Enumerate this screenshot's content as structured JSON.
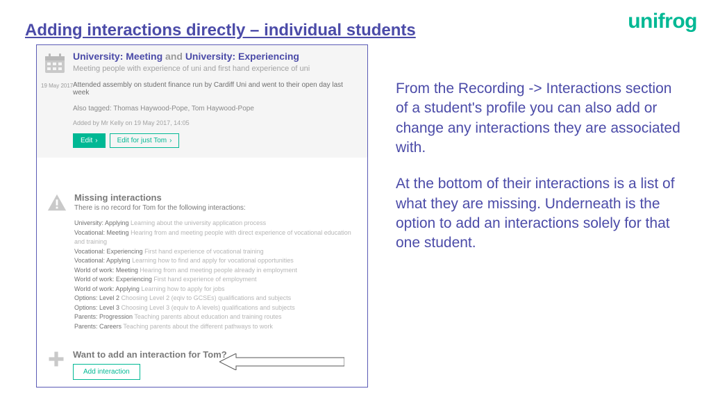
{
  "slide": {
    "title": "Adding interactions directly – individual students",
    "logo": "unifrog"
  },
  "card": {
    "title_a": "University: Meeting",
    "title_and": "and",
    "title_b": "University: Experiencing",
    "subtitle": "Meeting people with experience of uni and first hand experience of uni",
    "date": "19 May 2017",
    "detail": "Attended assembly on student finance run by Cardiff Uni and went to their open day last week",
    "also_tagged": "Also tagged: Thomas Haywood-Pope, Tom Haywood-Pope",
    "added_by": "Added by Mr Kelly on 19 May 2017, 14:05",
    "edit_label": "Edit",
    "edit_for_label": "Edit for just Tom"
  },
  "missing": {
    "title": "Missing interactions",
    "desc": "There is no record for Tom for the following interactions:",
    "items": [
      {
        "name": "University: Applying",
        "note": "Learning about the university application process"
      },
      {
        "name": "Vocational: Meeting",
        "note": "Hearing from and meeting people with direct experience of vocational education and training"
      },
      {
        "name": "Vocational: Experiencing",
        "note": "First hand experience of vocational training"
      },
      {
        "name": "Vocational: Applying",
        "note": "Learning how to find and apply for vocational opportunities"
      },
      {
        "name": "World of work: Meeting",
        "note": "Hearing from and meeting people already in employment"
      },
      {
        "name": "World of work: Experiencing",
        "note": "First hand experience of employment"
      },
      {
        "name": "World of work: Applying",
        "note": "Learning how to apply for jobs"
      },
      {
        "name": "Options: Level 2",
        "note": "Choosing Level 2 (eqiv to GCSEs) qualifications and subjects"
      },
      {
        "name": "Options: Level 3",
        "note": "Choosing Level 3 (equiv to A levels) qualifications and subjects"
      },
      {
        "name": "Parents: Progression",
        "note": "Teaching parents about education and training routes"
      },
      {
        "name": "Parents: Careers",
        "note": "Teaching parents about the different pathways to work"
      }
    ]
  },
  "add": {
    "title": "Want to add an interaction for Tom?",
    "button": "Add interaction"
  },
  "explainer": {
    "p1": "From the Recording -> Interactions section of a student's profile you can also add or change any interactions they are associated with.",
    "p2": "At the bottom of their interactions is a list of what they are missing. Underneath is the option to add an interactions solely for that one student."
  }
}
